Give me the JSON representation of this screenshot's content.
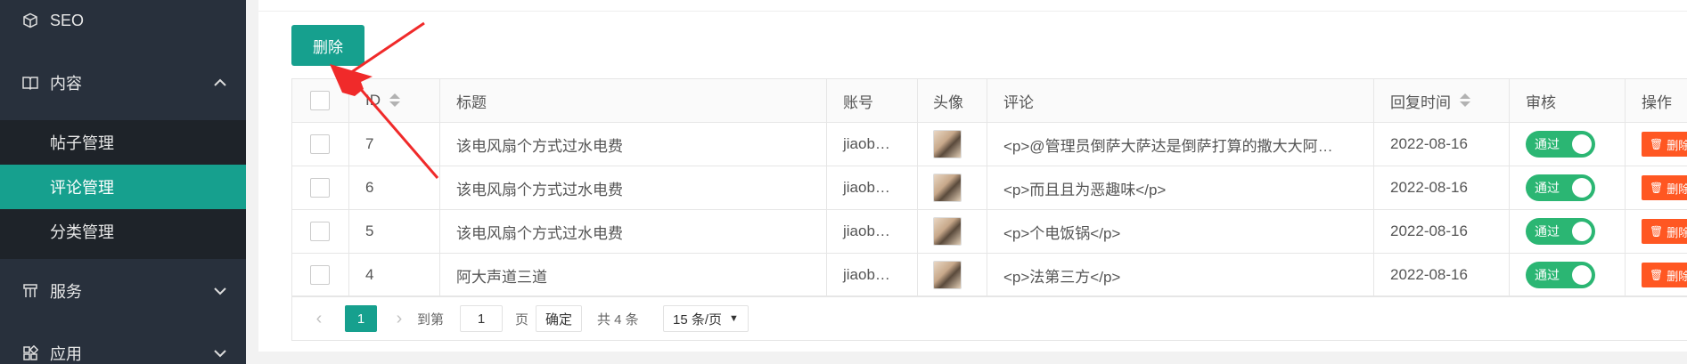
{
  "sidebar": {
    "items": [
      {
        "label": "SEO",
        "icon": "cube-icon"
      },
      {
        "label": "内容",
        "icon": "book-icon",
        "expanded": true
      },
      {
        "label": "服务",
        "icon": "service-icon"
      },
      {
        "label": "应用",
        "icon": "apps-icon"
      }
    ],
    "submenu": [
      "帖子管理",
      "评论管理",
      "分类管理"
    ],
    "active_sub": "评论管理"
  },
  "toolbar": {
    "delete_label": "删除"
  },
  "table": {
    "columns": [
      "ID",
      "标题",
      "账号",
      "头像",
      "评论",
      "回复时间",
      "审核",
      "操作"
    ],
    "rows": [
      {
        "id": "7",
        "title": "该电风扇个方式过水电费",
        "account": "jiaob…",
        "comment": "<p>@管理员倒萨大萨达是倒萨打算的撒大大阿…",
        "time": "2022-08-16",
        "audit": "通过",
        "op": "删除"
      },
      {
        "id": "6",
        "title": "该电风扇个方式过水电费",
        "account": "jiaob…",
        "comment": "<p>而且且为恶趣味</p>",
        "time": "2022-08-16",
        "audit": "通过",
        "op": "删除"
      },
      {
        "id": "5",
        "title": "该电风扇个方式过水电费",
        "account": "jiaob…",
        "comment": "<p>个电饭锅</p>",
        "time": "2022-08-16",
        "audit": "通过",
        "op": "删除"
      },
      {
        "id": "4",
        "title": "阿大声道三道",
        "account": "jiaob…",
        "comment": "<p>法第三方</p>",
        "time": "2022-08-16",
        "audit": "通过",
        "op": "删除"
      }
    ]
  },
  "pager": {
    "current": "1",
    "goto_label": "到第",
    "page_value": "1",
    "page_unit": "页",
    "confirm": "确定",
    "total": "共 4 条",
    "page_size": "15 条/页"
  },
  "colors": {
    "accent": "#16a08e",
    "sidebar_bg": "#28303c",
    "switch_on": "#2bb673",
    "danger": "#ff5722",
    "annotation": "#f02a2a"
  }
}
